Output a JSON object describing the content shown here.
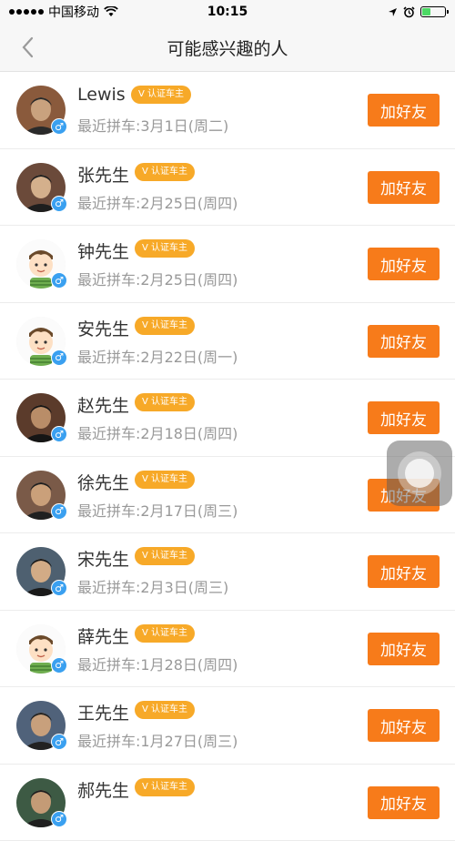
{
  "status_bar": {
    "carrier": "中国移动",
    "time": "10:15",
    "icons": [
      "signal-dots-icon",
      "wifi-icon",
      "location-arrow-icon",
      "alarm-clock-icon",
      "battery-icon"
    ]
  },
  "nav": {
    "title": "可能感兴趣的人",
    "back_icon": "chevron-left-icon"
  },
  "badge_label": "V 认证车主",
  "add_label": "加好友",
  "people": [
    {
      "name": "Lewis",
      "last_ride": "最近拼车:3月1日(周二)",
      "avatar": "photo"
    },
    {
      "name": "张先生",
      "last_ride": "最近拼车:2月25日(周四)",
      "avatar": "photo"
    },
    {
      "name": "钟先生",
      "last_ride": "最近拼车:2月25日(周四)",
      "avatar": "cartoon"
    },
    {
      "name": "安先生",
      "last_ride": "最近拼车:2月22日(周一)",
      "avatar": "cartoon"
    },
    {
      "name": "赵先生",
      "last_ride": "最近拼车:2月18日(周四)",
      "avatar": "photo"
    },
    {
      "name": "徐先生",
      "last_ride": "最近拼车:2月17日(周三)",
      "avatar": "photo"
    },
    {
      "name": "宋先生",
      "last_ride": "最近拼车:2月3日(周三)",
      "avatar": "photo"
    },
    {
      "name": "薛先生",
      "last_ride": "最近拼车:1月28日(周四)",
      "avatar": "cartoon"
    },
    {
      "name": "王先生",
      "last_ride": "最近拼车:1月27日(周三)",
      "avatar": "photo"
    },
    {
      "name": "郝先生",
      "last_ride": "",
      "avatar": "photo"
    }
  ],
  "gender_symbol": "♂",
  "colors": {
    "accent_button": "#f77b1a",
    "badge": "#f7a928",
    "gender": "#3aa0f0"
  }
}
